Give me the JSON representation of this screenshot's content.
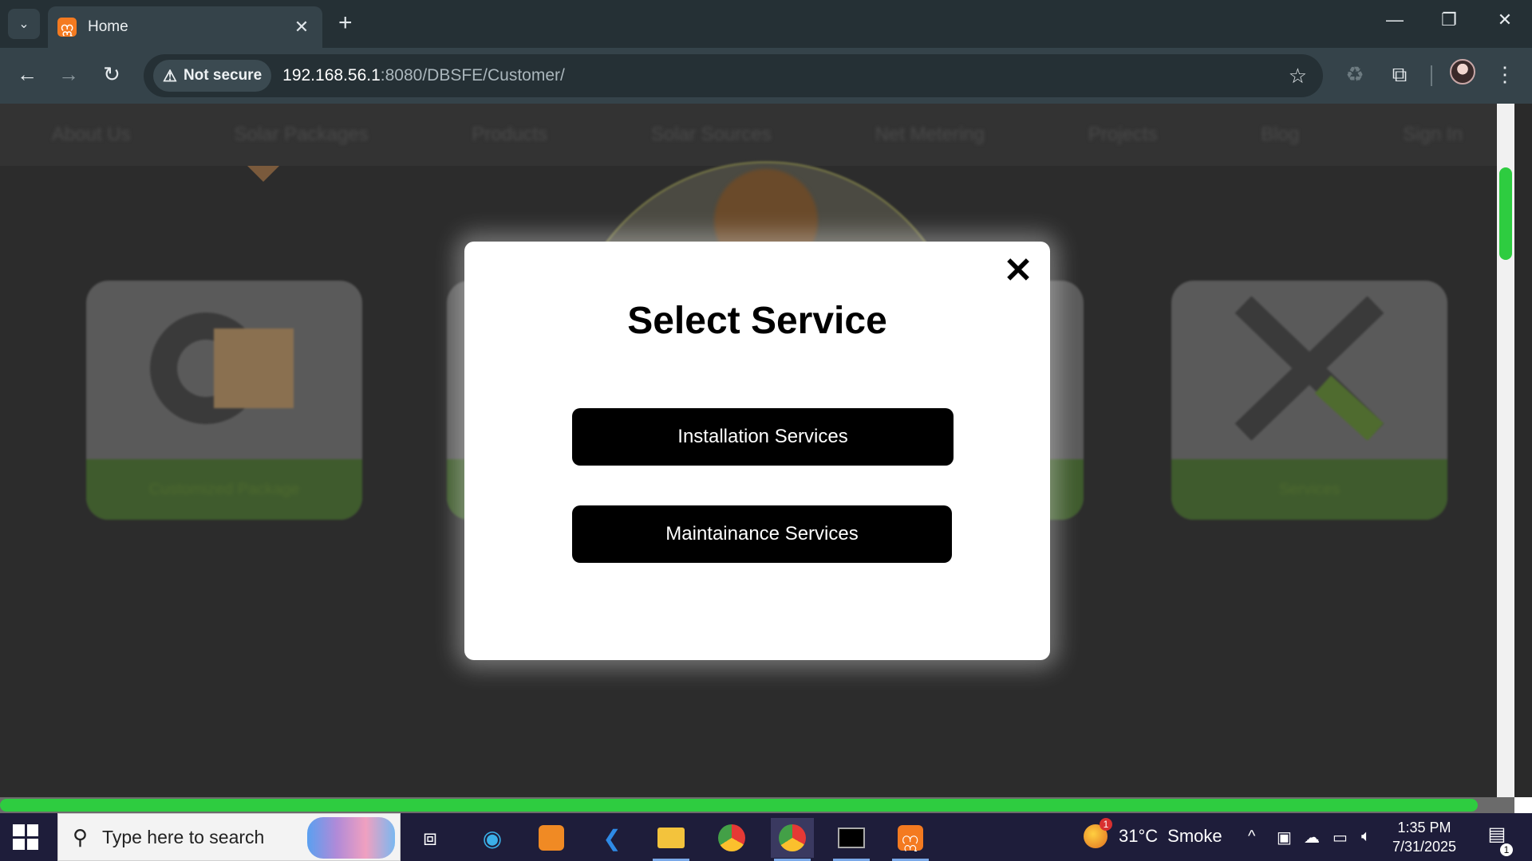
{
  "browser": {
    "tab_title": "Home",
    "tab_favicon_glyph": "ဣ",
    "new_tab_glyph": "+",
    "tab_close_glyph": "✕",
    "security_label": "Not secure",
    "url_host": "192.168.56.1",
    "url_path": ":8080/DBSFE/Customer/"
  },
  "site_nav": {
    "items": [
      "About Us",
      "Solar Packages",
      "Products",
      "Solar Sources",
      "Net Metering",
      "Projects",
      "Blog",
      "Sign In"
    ]
  },
  "cards": [
    {
      "label": "Customized Package"
    },
    {
      "label": "Services"
    }
  ],
  "modal": {
    "title": "Select Service",
    "close_glyph": "✕",
    "buttons": {
      "installation": "Installation Services",
      "maintenance": "Maintainance Services"
    }
  },
  "taskbar": {
    "search_placeholder": "Type here to search",
    "weather_temp": "31°C",
    "weather_desc": "Smoke",
    "weather_badge": "1",
    "time": "1:35 PM",
    "date": "7/31/2025",
    "notification_count": "1"
  },
  "colors": {
    "accent_green": "#2ecc40",
    "modal_button": "#000000",
    "tab_favicon": "#f47a20"
  }
}
